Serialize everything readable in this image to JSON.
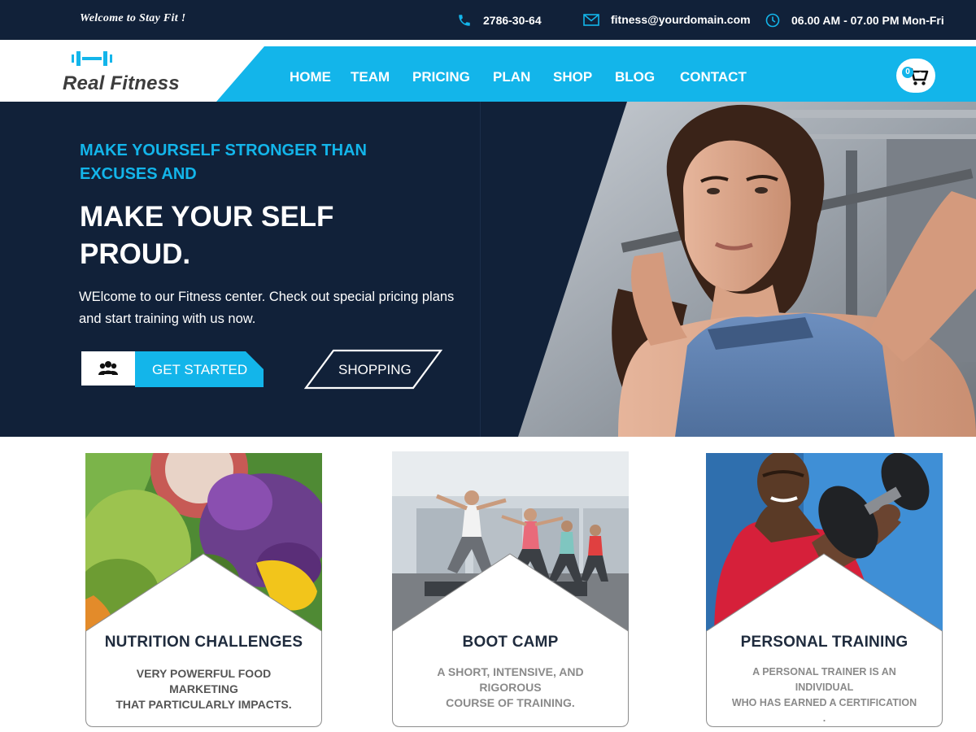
{
  "topbar": {
    "welcome": "Welcome to Stay Fit !",
    "phone": "2786-30-64",
    "email": "fitness@yourdomain.com",
    "hours": "06.00 AM -  07.00 PM  Mon-Fri",
    "icons": [
      "phone-icon",
      "mail-icon",
      "clock-icon"
    ]
  },
  "brand": {
    "name": "Real Fitness",
    "icon": "dumbbell-icon"
  },
  "nav": {
    "items": [
      "HOME",
      "TEAM",
      "PRICING",
      "PLAN",
      "SHOP",
      "BLOG",
      "CONTACT"
    ],
    "cart_count": "0",
    "cart_icon": "cart-plus-icon"
  },
  "hero": {
    "tagline_line1": "MAKE  YOURSELF STRONGER THAN",
    "tagline_line2": "EXCUSES AND",
    "title_line1": "MAKE YOUR SELF",
    "title_line2": "PROUD.",
    "text_line1": "WElcome to our Fitness center. Check out special pricing plans",
    "text_line2": "and start  training with us now.",
    "primary_button": "GET STARTED",
    "primary_button_icon": "users-icon",
    "secondary_button": "SHOPPING"
  },
  "cards": [
    {
      "title": "NUTRITION CHALLENGES",
      "desc_line1": "VERY POWERFUL FOOD MARKETING",
      "desc_line2": "THAT PARTICULARLY IMPACTS."
    },
    {
      "title": "BOOT CAMP",
      "desc_line1": "A SHORT, INTENSIVE, AND RIGOROUS",
      "desc_line2": "COURSE OF TRAINING."
    },
    {
      "title": "PERSONAL TRAINING",
      "desc_line1": "A PERSONAL TRAINER IS AN INDIVIDUAL",
      "desc_line2": "WHO HAS EARNED A CERTIFICATION ."
    }
  ],
  "colors": {
    "navy": "#112139",
    "accent": "#13b5ea",
    "white": "#ffffff"
  }
}
